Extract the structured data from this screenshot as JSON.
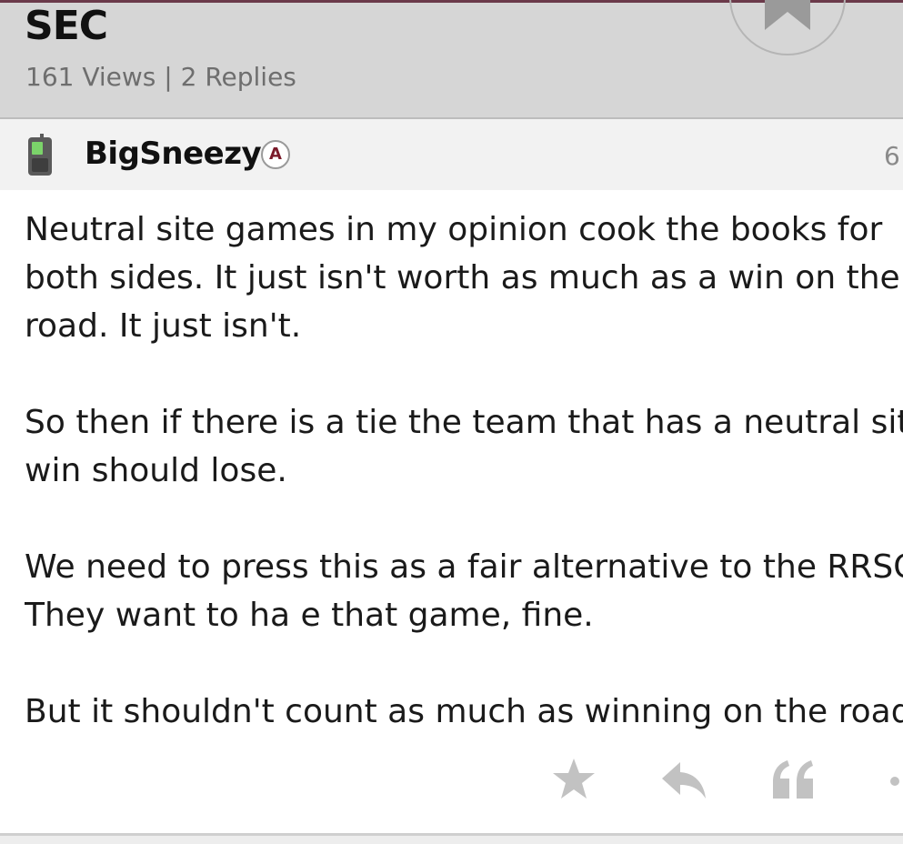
{
  "thread": {
    "title": "SEC",
    "meta": "161 Views | 2 Replies"
  },
  "post": {
    "author": "BigSneezy",
    "badge": "A",
    "time": "6",
    "paragraphs": [
      [
        "Neutral site games in my opinion cook the books for",
        "both sides. It just isn't worth as much as a win on the",
        "road. It just isn't."
      ],
      [
        "So then if there is a tie the team that has a neutral site",
        "win should lose."
      ],
      [
        "We need to press this as a fair alternative to the RRSC",
        "They want to ha e that game, fine."
      ],
      [
        "But it shouldn't count as much as winning on the road"
      ]
    ]
  },
  "icons": {
    "bookmark": "bookmark-icon",
    "device": "mobile-phone-icon",
    "like": "star-icon",
    "reply": "reply-icon",
    "quote": "quote-icon",
    "more": "more-icon"
  },
  "colors": {
    "header_bg": "#d6d6d6",
    "accent": "#6b3a4a",
    "badge_letter": "#7a1a2a",
    "action_icon": "#c2c2c2"
  }
}
